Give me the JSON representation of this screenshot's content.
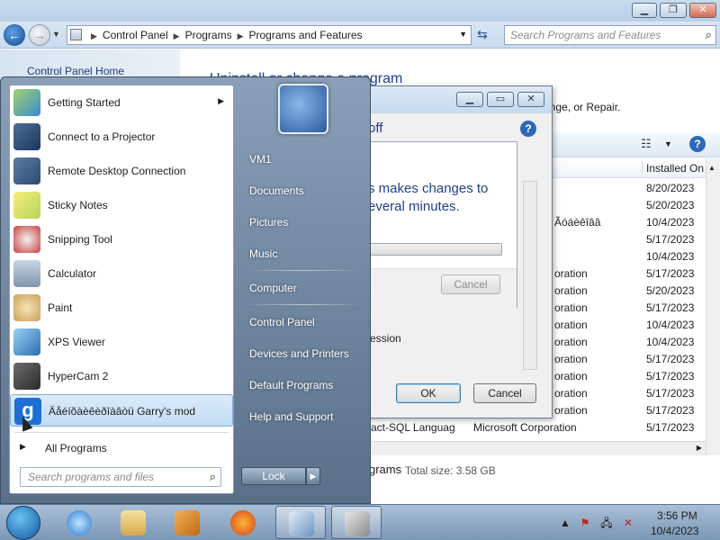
{
  "explorer": {
    "breadcrumb": [
      "Control Panel",
      "Programs",
      "Programs and Features"
    ],
    "search_placeholder": "Search Programs and Features",
    "left_link": "Control Panel Home",
    "main_title": "Uninstall or change a program",
    "main_desc": "ange, or Repair.",
    "column_installed": "Installed On",
    "rows": [
      {
        "publisher": "",
        "date": "8/20/2023"
      },
      {
        "publisher": "",
        "date": "5/20/2023"
      },
      {
        "publisher": "Ãóáèêîââ",
        "date": "10/4/2023"
      },
      {
        "publisher": "",
        "date": "5/17/2023"
      },
      {
        "publisher": "",
        "date": "10/4/2023"
      },
      {
        "publisher": "oration",
        "date": "5/17/2023"
      },
      {
        "publisher": "oration",
        "date": "5/20/2023"
      },
      {
        "publisher": "oration",
        "date": "5/17/2023"
      },
      {
        "publisher": "oration",
        "date": "10/4/2023"
      },
      {
        "publisher": "oration",
        "date": "10/4/2023"
      },
      {
        "publisher": "oration",
        "date": "5/17/2023"
      },
      {
        "publisher": "oration",
        "date": "5/17/2023"
      },
      {
        "publisher": "oration",
        "date": "5/17/2023"
      },
      {
        "publisher": "oration",
        "date": "5/17/2023"
      },
      {
        "publisher": "Microsoft Corporation",
        "date": "5/17/2023"
      }
    ],
    "row_partial_name": "act-SQL Languag",
    "status_programs": "grams",
    "status_total": "Total size: 3.58 GB"
  },
  "dialog": {
    "title_partial": "off",
    "text_partial": "ession",
    "ok_label": "OK",
    "cancel_label": "Cancel"
  },
  "progress_popup": {
    "line1": "s makes changes to",
    "line2": "everal minutes.",
    "cancel_label": "Cancel"
  },
  "start_menu": {
    "left_items": [
      {
        "label": "Getting Started",
        "icon": "getting-started-icon",
        "has_submenu": true
      },
      {
        "label": "Connect to a Projector",
        "icon": "projector-icon"
      },
      {
        "label": "Remote Desktop Connection",
        "icon": "remote-desktop-icon"
      },
      {
        "label": "Sticky Notes",
        "icon": "sticky-notes-icon"
      },
      {
        "label": "Snipping Tool",
        "icon": "snipping-tool-icon"
      },
      {
        "label": "Calculator",
        "icon": "calculator-icon"
      },
      {
        "label": "Paint",
        "icon": "paint-icon"
      },
      {
        "label": "XPS Viewer",
        "icon": "xps-viewer-icon"
      },
      {
        "label": "HyperCam 2",
        "icon": "hypercam-icon"
      },
      {
        "label": "Äåéíõàèêèðîàâòü Garry's mod",
        "icon": "garrys-mod-icon"
      }
    ],
    "all_programs": "All Programs",
    "search_placeholder": "Search programs and files",
    "right_items": [
      "VM1",
      "Documents",
      "Pictures",
      "Music",
      "Computer",
      "Control Panel",
      "Devices and Printers",
      "Default Programs",
      "Help and Support"
    ],
    "lock_label": "Lock"
  },
  "taskbar": {
    "time": "3:56 PM",
    "date": "10/4/2023"
  }
}
